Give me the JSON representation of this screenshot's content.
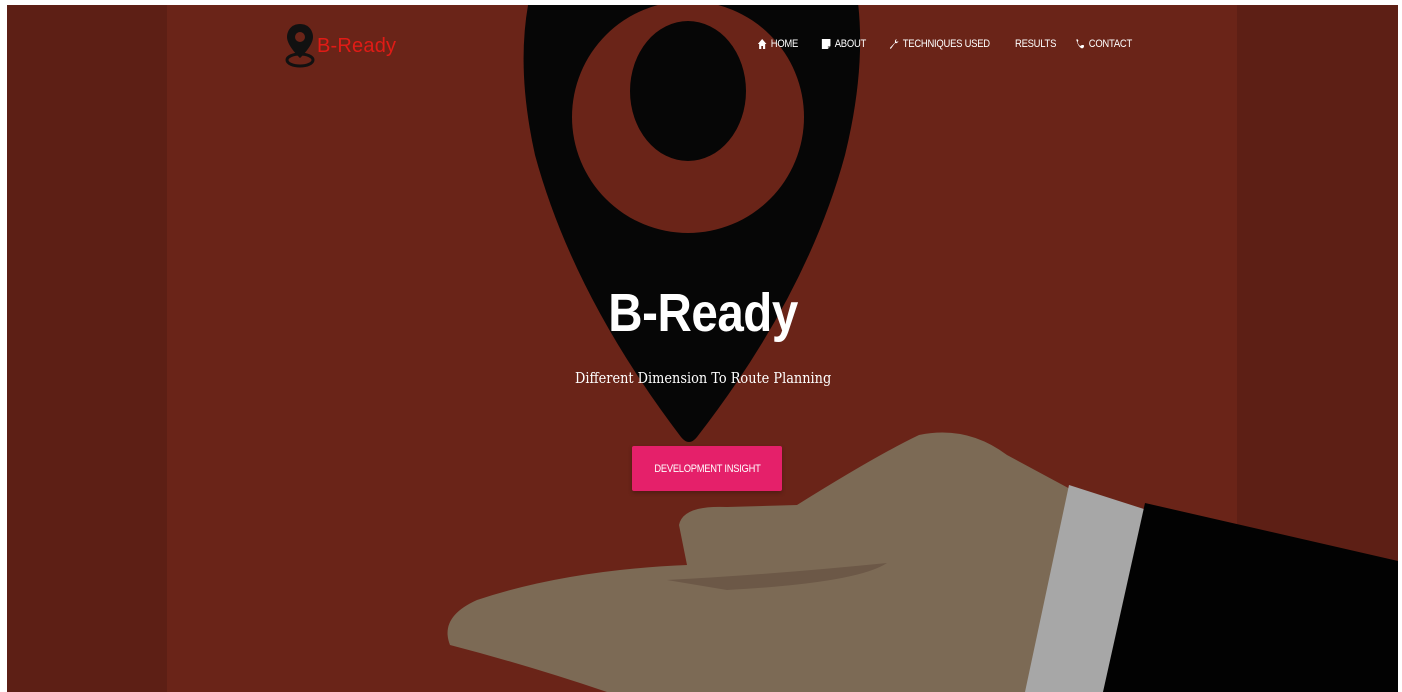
{
  "brand": {
    "logo_icon": "map-pin-icon",
    "name": "B-Ready",
    "color": "#e11b16"
  },
  "nav": {
    "items": [
      {
        "label": "HOME",
        "icon": "home-icon"
      },
      {
        "label": "ABOUT",
        "icon": "document-icon"
      },
      {
        "label": "TECHNIQUES USED",
        "icon": "wrench-icon"
      },
      {
        "label": "RESULTS",
        "icon": ""
      },
      {
        "label": "CONTACT",
        "icon": "phone-icon"
      }
    ]
  },
  "hero": {
    "title": "B-Ready",
    "subtitle": "Different Dimension To Route Planning",
    "cta_label": "DEVELOPMENT INSIGHT",
    "cta_color": "#e5206a",
    "background_color": "#6a2418"
  }
}
